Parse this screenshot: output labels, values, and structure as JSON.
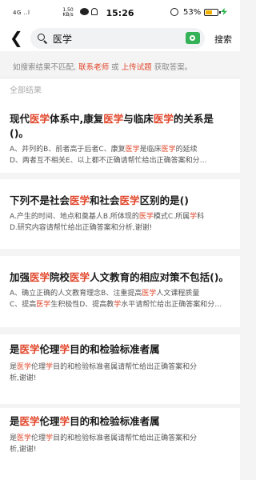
{
  "status_bar": {
    "signal": "4G ..l",
    "net_speed_top": "1.50",
    "net_speed_bottom": "KB/s",
    "time": "15:26",
    "battery_pct": "53%",
    "icons": [
      "signal-icon",
      "wifi-icon",
      "wechat-icon",
      "notification-icon",
      "alarm-icon",
      "battery-icon",
      "charging-icon"
    ]
  },
  "search": {
    "query": "医学",
    "button_label": "搜索",
    "back_icon": "chevron-left-icon",
    "camera_icon": "camera-icon",
    "accent": "#35b257"
  },
  "hint": {
    "prefix": "如搜索结果不匹配,",
    "contact_link": "联系老师",
    "middle": "或",
    "upload_link": "上传试题",
    "suffix": "获取答案。"
  },
  "section_title": "全部结果",
  "highlight_color": "#e1462b",
  "results": [
    {
      "title": [
        [
          "现代",
          0
        ],
        [
          "医学",
          1
        ],
        [
          "体系中,康复",
          0
        ],
        [
          "医学",
          1
        ],
        [
          "与临床",
          0
        ],
        [
          "医学",
          1
        ],
        [
          "的关系是",
          0
        ]
      ],
      "title2": [
        [
          "()。",
          0
        ]
      ],
      "desc1": [
        [
          "A、并列的B、前者高于后者C、康复",
          0
        ],
        [
          "医学",
          1
        ],
        [
          "是临床",
          0
        ],
        [
          "医学",
          1
        ],
        [
          "的延续",
          0
        ]
      ],
      "desc2": [
        [
          "D、两者互不相关E、以上都不正确请帮忙给出正确答案和分…",
          0
        ]
      ]
    },
    {
      "title": [
        [
          "下列不是社会",
          0
        ],
        [
          "医学",
          1
        ],
        [
          "和社会",
          0
        ],
        [
          "医学",
          1
        ],
        [
          "区别的是()",
          0
        ]
      ],
      "desc1": [
        [
          "A.产生的时间、地点和奠基人B.所体现的",
          0
        ],
        [
          "医学",
          1
        ],
        [
          "模式C.所属",
          0
        ],
        [
          "学",
          1
        ],
        [
          "科",
          0
        ]
      ],
      "desc2": [
        [
          "D.研究内容请帮忙给出正确答案和分析,谢谢!",
          0
        ]
      ]
    },
    {
      "title": [
        [
          "加强",
          0
        ],
        [
          "医学",
          1
        ],
        [
          "院校",
          0
        ],
        [
          "医学",
          1
        ],
        [
          "人文教育的相应对策不包括()。",
          0
        ]
      ],
      "desc1": [
        [
          "A、确立正确的人文教育理念B、注重提高",
          0
        ],
        [
          "医学",
          1
        ],
        [
          "人文课程质量",
          0
        ]
      ],
      "desc2": [
        [
          "C、提高",
          0
        ],
        [
          "医学",
          1
        ],
        [
          "生积极性D、提高教",
          0
        ],
        [
          "学",
          1
        ],
        [
          "水平请帮忙给出正确答案和分…",
          0
        ]
      ]
    },
    {
      "title": [
        [
          "是",
          0
        ],
        [
          "医学",
          1
        ],
        [
          "伦理",
          0
        ],
        [
          "学",
          1
        ],
        [
          "目的和检验标准者属",
          0
        ]
      ],
      "desc1": [
        [
          "是",
          0
        ],
        [
          "医学",
          1
        ],
        [
          "伦理",
          0
        ],
        [
          "学",
          1
        ],
        [
          "目的和检验标准者属请帮忙给出正确答案和分",
          0
        ]
      ],
      "desc2": [
        [
          "析,谢谢!",
          0
        ]
      ]
    },
    {
      "title": [
        [
          "是",
          0
        ],
        [
          "医学",
          1
        ],
        [
          "伦理",
          0
        ],
        [
          "学",
          1
        ],
        [
          "目的和检验标准者属",
          0
        ]
      ],
      "desc1": [
        [
          "是",
          0
        ],
        [
          "医学",
          1
        ],
        [
          "伦理",
          0
        ],
        [
          "学",
          1
        ],
        [
          "目的和检验标准者属请帮忙给出正确答案和分",
          0
        ]
      ],
      "desc2": [
        [
          "析,谢谢!",
          0
        ]
      ]
    }
  ]
}
